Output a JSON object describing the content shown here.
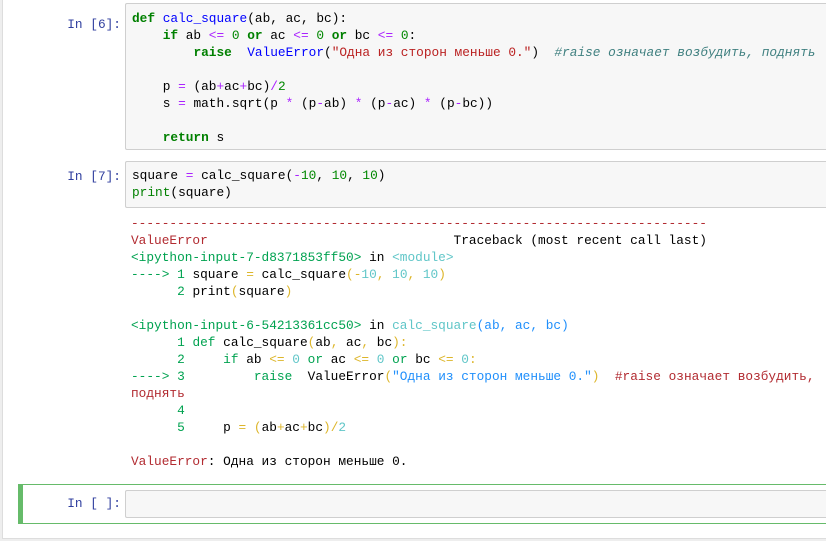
{
  "cells": [
    {
      "prompt": "In [6]:",
      "lines": [
        [
          [
            "def",
            "kw"
          ],
          [
            " "
          ],
          [
            "calc_square",
            "fn"
          ],
          [
            "(ab, ac, bc):"
          ]
        ],
        [
          [
            "    "
          ],
          [
            "if",
            "kw"
          ],
          [
            " ab "
          ],
          [
            "<=",
            "op"
          ],
          [
            " "
          ],
          [
            "0",
            "num"
          ],
          [
            " "
          ],
          [
            "or",
            "kw"
          ],
          [
            " ac "
          ],
          [
            "<=",
            "op"
          ],
          [
            " "
          ],
          [
            "0",
            "num"
          ],
          [
            " "
          ],
          [
            "or",
            "kw"
          ],
          [
            " bc "
          ],
          [
            "<=",
            "op"
          ],
          [
            " "
          ],
          [
            "0",
            "num"
          ],
          [
            ":"
          ]
        ],
        [
          [
            "        "
          ],
          [
            "raise",
            "kw"
          ],
          [
            "  "
          ],
          [
            "ValueError",
            "fn"
          ],
          [
            "("
          ],
          [
            "\"Одна из сторон меньше 0.\"",
            "str"
          ],
          [
            ")  "
          ],
          [
            "#raise означает возбудить, поднять",
            "cm"
          ]
        ],
        [
          [
            ""
          ]
        ],
        [
          [
            "    p "
          ],
          [
            "=",
            "op"
          ],
          [
            " (ab"
          ],
          [
            "+",
            "op"
          ],
          [
            "ac"
          ],
          [
            "+",
            "op"
          ],
          [
            "bc)"
          ],
          [
            "/",
            "op"
          ],
          [
            "2",
            "num"
          ]
        ],
        [
          [
            "    s "
          ],
          [
            "=",
            "op"
          ],
          [
            " math"
          ],
          [
            "."
          ],
          [
            "sqrt(p "
          ],
          [
            "*",
            "op"
          ],
          [
            " (p"
          ],
          [
            "-",
            "op"
          ],
          [
            "ab) "
          ],
          [
            "*",
            "op"
          ],
          [
            " (p"
          ],
          [
            "-",
            "op"
          ],
          [
            "ac) "
          ],
          [
            "*",
            "op"
          ],
          [
            " (p"
          ],
          [
            "-",
            "op"
          ],
          [
            "bc))"
          ]
        ],
        [
          [
            ""
          ]
        ],
        [
          [
            "    "
          ],
          [
            "return",
            "kw"
          ],
          [
            " s"
          ]
        ]
      ]
    },
    {
      "prompt": "In [7]:",
      "lines": [
        [
          [
            "square "
          ],
          [
            "=",
            "op"
          ],
          [
            " calc_square("
          ],
          [
            "-",
            "op"
          ],
          [
            "10",
            "num"
          ],
          [
            ", "
          ],
          [
            "10",
            "num"
          ],
          [
            ", "
          ],
          [
            "10",
            "num"
          ],
          [
            ")"
          ]
        ],
        [
          [
            "print",
            "bi"
          ],
          [
            "(square)"
          ]
        ]
      ],
      "output": [
        [
          [
            "---------------------------------------------------------------------------",
            "tr"
          ]
        ],
        [
          [
            "ValueError",
            "tr"
          ],
          [
            "                                Traceback (most recent call last)"
          ]
        ],
        [
          [
            "<ipython-input-7-d8371853ff50>",
            "tg"
          ],
          [
            " in "
          ],
          [
            "<module>",
            "tc"
          ]
        ],
        [
          [
            "----> 1 ",
            "tg"
          ],
          [
            "square "
          ],
          [
            "=",
            "ty"
          ],
          [
            " calc_square"
          ],
          [
            "(",
            "ty"
          ],
          [
            "-",
            "ty"
          ],
          [
            "10",
            "tc"
          ],
          [
            ", ",
            "ty"
          ],
          [
            "10",
            "tc"
          ],
          [
            ", ",
            "ty"
          ],
          [
            "10",
            "tc"
          ],
          [
            ")",
            "ty"
          ]
        ],
        [
          [
            "      2 ",
            "tg"
          ],
          [
            "print"
          ],
          [
            "(",
            "ty"
          ],
          [
            "square"
          ],
          [
            ")",
            "ty"
          ]
        ],
        [
          [
            ""
          ]
        ],
        [
          [
            "<ipython-input-6-54213361cc50>",
            "tg"
          ],
          [
            " in "
          ],
          [
            "calc_square",
            "tc"
          ],
          [
            "(ab, ac, bc)",
            "tb"
          ]
        ],
        [
          [
            "      1 ",
            "tg"
          ],
          [
            "def",
            "tg"
          ],
          [
            " calc_square"
          ],
          [
            "(",
            "ty"
          ],
          [
            "ab"
          ],
          [
            ", ",
            "ty"
          ],
          [
            "ac"
          ],
          [
            ", ",
            "ty"
          ],
          [
            "bc"
          ],
          [
            "):",
            "ty"
          ]
        ],
        [
          [
            "      2 ",
            "tg"
          ],
          [
            "    "
          ],
          [
            "if",
            "tg"
          ],
          [
            " ab "
          ],
          [
            "<=",
            "ty"
          ],
          [
            " "
          ],
          [
            "0",
            "tc"
          ],
          [
            " "
          ],
          [
            "or",
            "tg"
          ],
          [
            " ac "
          ],
          [
            "<=",
            "ty"
          ],
          [
            " "
          ],
          [
            "0",
            "tc"
          ],
          [
            " "
          ],
          [
            "or",
            "tg"
          ],
          [
            " bc "
          ],
          [
            "<=",
            "ty"
          ],
          [
            " "
          ],
          [
            "0",
            "tc"
          ],
          [
            ":",
            "ty"
          ]
        ],
        [
          [
            "----> 3 ",
            "tg"
          ],
          [
            "        "
          ],
          [
            "raise",
            "tg"
          ],
          [
            "  ValueError"
          ],
          [
            "(",
            "ty"
          ],
          [
            "\"Одна из сторон меньше 0.\"",
            "tb"
          ],
          [
            ")",
            "ty"
          ],
          [
            "  "
          ],
          [
            "#raise означает возбудить, поднять",
            "tr"
          ]
        ],
        [
          [
            "      4 ",
            "tg"
          ]
        ],
        [
          [
            "      5 ",
            "tg"
          ],
          [
            "    p "
          ],
          [
            "=",
            "ty"
          ],
          [
            " "
          ],
          [
            "(",
            "ty"
          ],
          [
            "ab"
          ],
          [
            "+",
            "ty"
          ],
          [
            "ac"
          ],
          [
            "+",
            "ty"
          ],
          [
            "bc"
          ],
          [
            ")",
            "ty"
          ],
          [
            "/",
            "ty"
          ],
          [
            "2",
            "tc"
          ]
        ],
        [
          [
            ""
          ]
        ],
        [
          [
            "ValueError",
            "tr"
          ],
          [
            ": Одна из сторон меньше 0."
          ]
        ]
      ]
    },
    {
      "prompt": "In [ ]:",
      "lines": []
    }
  ]
}
